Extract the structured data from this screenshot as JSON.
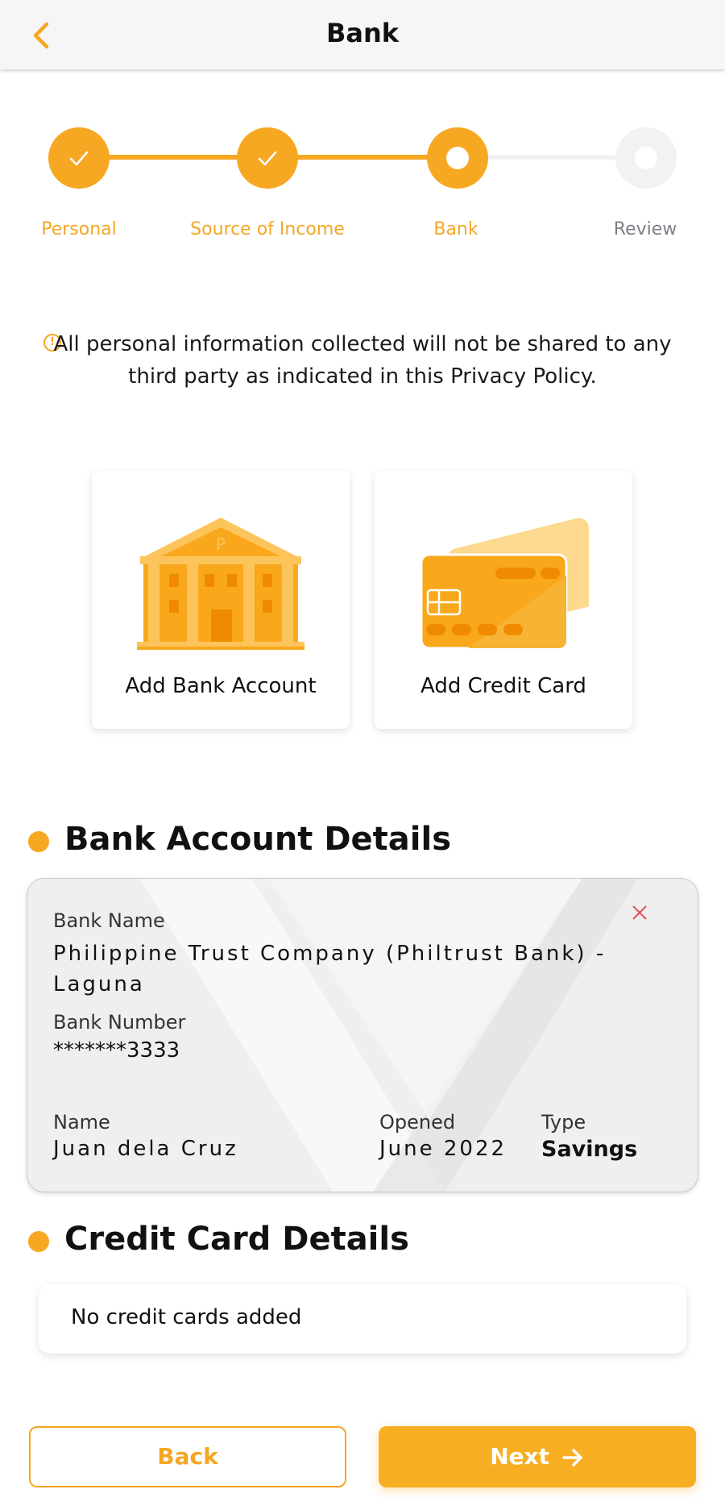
{
  "header": {
    "title": "Bank"
  },
  "stepper": {
    "steps": [
      {
        "label": "Personal",
        "state": "done"
      },
      {
        "label": "Source of Income",
        "state": "done"
      },
      {
        "label": "Bank",
        "state": "active"
      },
      {
        "label": "Review",
        "state": "pending"
      }
    ]
  },
  "privacy_notice": "All personal information collected will not be shared to any third party as indicated in this Privacy Policy.",
  "add_options": {
    "bank_label": "Add Bank Account",
    "card_label": "Add Credit Card"
  },
  "bank_section": {
    "title": "Bank Account Details",
    "card": {
      "bank_name_label": "Bank Name",
      "bank_name": "Philippine Trust Company (Philtrust Bank) - Laguna",
      "bank_number_label": "Bank Number",
      "bank_number": "*******3333",
      "name_label": "Name",
      "name": "Juan dela Cruz",
      "opened_label": "Opened",
      "opened": "June 2022",
      "type_label": "Type",
      "type": "Savings"
    }
  },
  "credit_section": {
    "title": "Credit Card Details",
    "empty_text": "No credit cards added"
  },
  "footer": {
    "back_label": "Back",
    "next_label": "Next"
  },
  "colors": {
    "accent": "#f7a823",
    "pending": "#f1f2f4",
    "close": "#e05555"
  }
}
